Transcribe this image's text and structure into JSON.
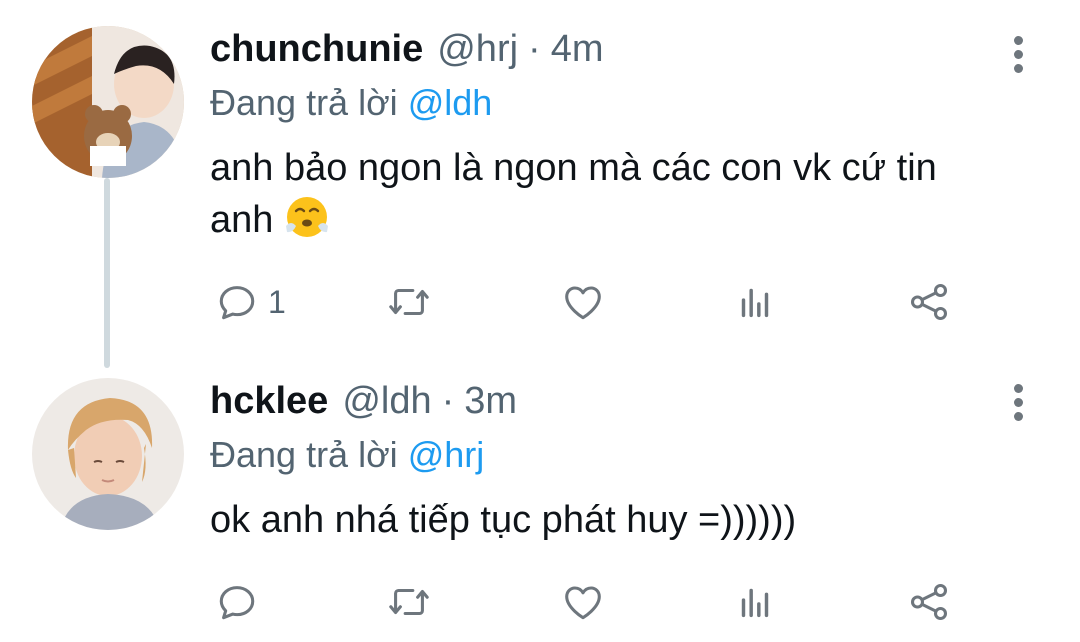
{
  "tweets": [
    {
      "display_name": "chunchunie",
      "handle": "@hrj",
      "separator": "·",
      "time": "4m",
      "reply_prefix": "Đang trả lời",
      "reply_to": "@ldh",
      "text": "anh bảo ngon là ngon mà các con vk cứ tin anh",
      "emoji": "face-with-steam-from-nose",
      "reply_count": "1"
    },
    {
      "display_name": "hcklee",
      "handle": "@ldh",
      "separator": "·",
      "time": "3m",
      "reply_prefix": "Đang trả lời",
      "reply_to": "@hrj",
      "text": "ok anh nhá tiếp tục phát huy =))))))",
      "reply_count": ""
    }
  ],
  "icons": [
    "reply-icon",
    "retweet-icon",
    "like-icon",
    "views-icon",
    "share-icon",
    "more-options-icon"
  ],
  "colors": {
    "link": "#1d9bf0",
    "muted": "#536471",
    "icon": "#6e767d",
    "thread_line": "#cfd9de"
  }
}
